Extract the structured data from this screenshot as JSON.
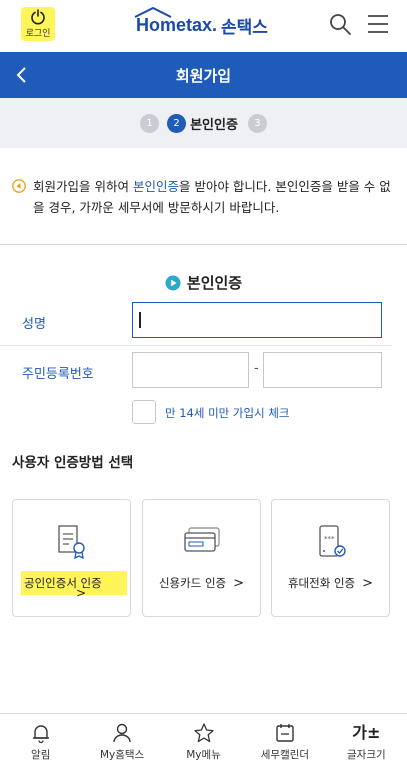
{
  "header": {
    "login_label": "로그인",
    "logo_en": "Hometax.",
    "logo_ko": "손택스"
  },
  "titlebar": {
    "title": "회원가입"
  },
  "stepper": {
    "steps": [
      "1",
      "2",
      "3"
    ],
    "active_index": 2,
    "active_label": "본인인증"
  },
  "notice": {
    "before": "회원가입을 위하여 ",
    "highlight": "본인인증",
    "after": "을 받아야 합니다. 본인인증을 받을 수 없을 경우, 가까운 세무서에 방문하시기 바랍니다."
  },
  "section": {
    "title": "본인인증"
  },
  "form": {
    "name_label": "성명",
    "name_value": "",
    "rrn_label": "주민등록번호",
    "rrn_front_value": "",
    "rrn_dash": "-",
    "rrn_back_value": "",
    "under14_label": "만 14세 미만 가입시 체크",
    "under14_checked": false
  },
  "methods": {
    "title": "사용자 인증방법 선택",
    "items": [
      {
        "label": "공인인증서 인증",
        "icon": "certificate-icon",
        "chevron": ">"
      },
      {
        "label": "신용카드 인증",
        "icon": "credit-card-icon",
        "chevron": ">"
      },
      {
        "label": "휴대전화 인증",
        "icon": "mobile-phone-icon",
        "chevron": ">"
      }
    ]
  },
  "bottom_nav": [
    {
      "label": "알림",
      "icon": "bell-icon"
    },
    {
      "label": "My홈택스",
      "icon": "user-icon"
    },
    {
      "label": "My메뉴",
      "icon": "star-icon"
    },
    {
      "label": "세무캘린더",
      "icon": "calendar-icon"
    },
    {
      "label": "글자크기",
      "icon": "font-size-icon",
      "glyph": "가±"
    }
  ],
  "colors": {
    "brand_blue": "#1f5bb8",
    "highlight_yellow": "#fff45a",
    "stepper_bg": "#eef0f4"
  }
}
